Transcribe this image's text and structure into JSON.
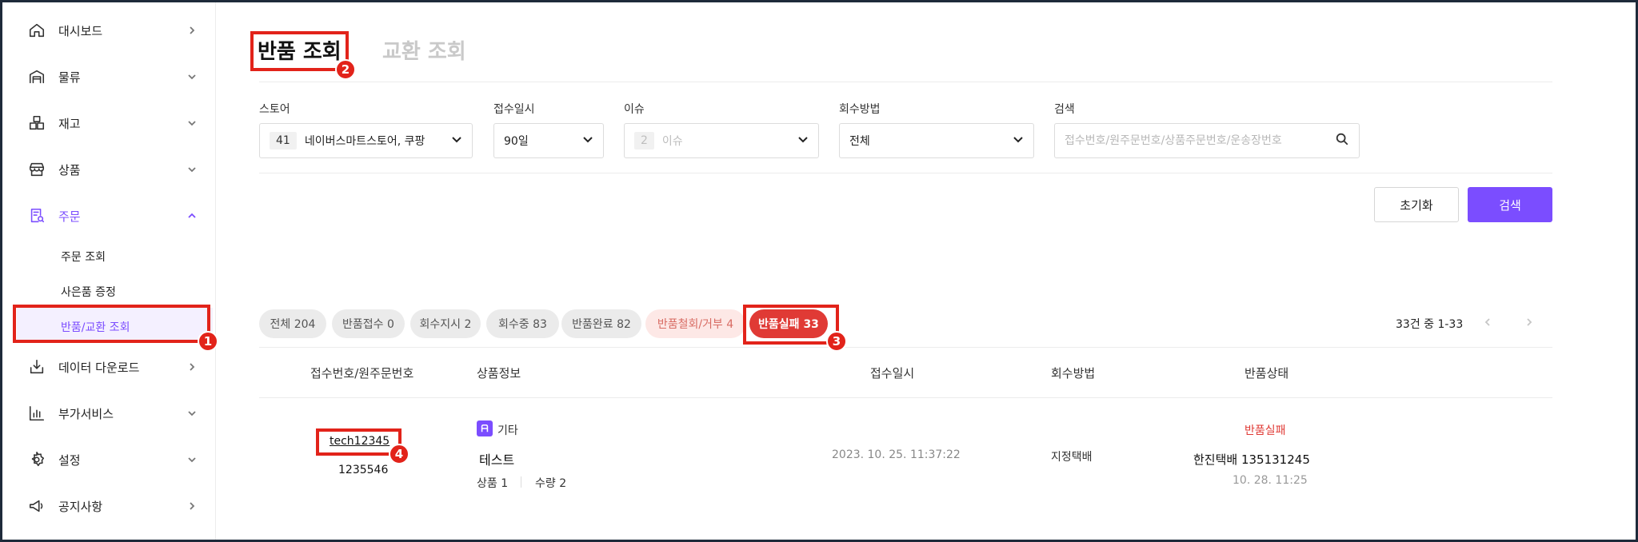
{
  "sidebar": {
    "items": [
      {
        "label": "대시보드",
        "icon": "home-icon"
      },
      {
        "label": "물류",
        "icon": "warehouse-icon"
      },
      {
        "label": "재고",
        "icon": "boxes-icon"
      },
      {
        "label": "상품",
        "icon": "store-icon"
      },
      {
        "label": "주문",
        "icon": "order-search-icon"
      },
      {
        "label": "데이터 다운로드",
        "icon": "download-icon"
      },
      {
        "label": "부가서비스",
        "icon": "chart-icon"
      },
      {
        "label": "설정",
        "icon": "gear-icon"
      },
      {
        "label": "공지사항",
        "icon": "megaphone-icon"
      }
    ],
    "order_sub": [
      "주문 조회",
      "사은품 증정",
      "반품/교환 조회"
    ]
  },
  "tabs": {
    "returns": "반품 조회",
    "exchange": "교환 조회"
  },
  "filters": {
    "store": {
      "label": "스토어",
      "count": "41",
      "value": "네이버스마트스토어, 쿠팡"
    },
    "date": {
      "label": "접수일시",
      "value": "90일"
    },
    "issue": {
      "label": "이슈",
      "count": "2",
      "value": "이슈"
    },
    "method": {
      "label": "회수방법",
      "value": "전체"
    },
    "search": {
      "label": "검색",
      "placeholder": "접수번호/원주문번호/상품주문번호/운송장번호"
    }
  },
  "buttons": {
    "reset": "초기화",
    "search": "검색"
  },
  "status_chips": [
    "전체 204",
    "반품접수 0",
    "회수지시 2",
    "회수중 83",
    "반품완료 82",
    "반품철회/거부 4",
    "반품실패 33"
  ],
  "pagination": {
    "summary": "33건 중 1-33"
  },
  "table": {
    "headers": [
      "접수번호/원주문번호",
      "상품정보",
      "접수일시",
      "회수방법",
      "반품상태"
    ],
    "rows": [
      {
        "receipt_no": "tech12345",
        "order_no": "1235546",
        "product_tag": "기타",
        "product_name": "테스트",
        "product_count": "상품 1",
        "quantity": "수량 2",
        "received_at": "2023. 10. 25. 11:37:22",
        "method": "지정택배",
        "status": "반품실패",
        "courier": "한진택배 135131245",
        "status_time": "10. 28. 11:25"
      }
    ]
  },
  "annotations": [
    "1",
    "2",
    "3",
    "4"
  ],
  "colors": {
    "accent": "#7b4dff",
    "annotation": "#e2231a",
    "failed": "#e03a35",
    "rejected_bg": "#fde8e6"
  }
}
